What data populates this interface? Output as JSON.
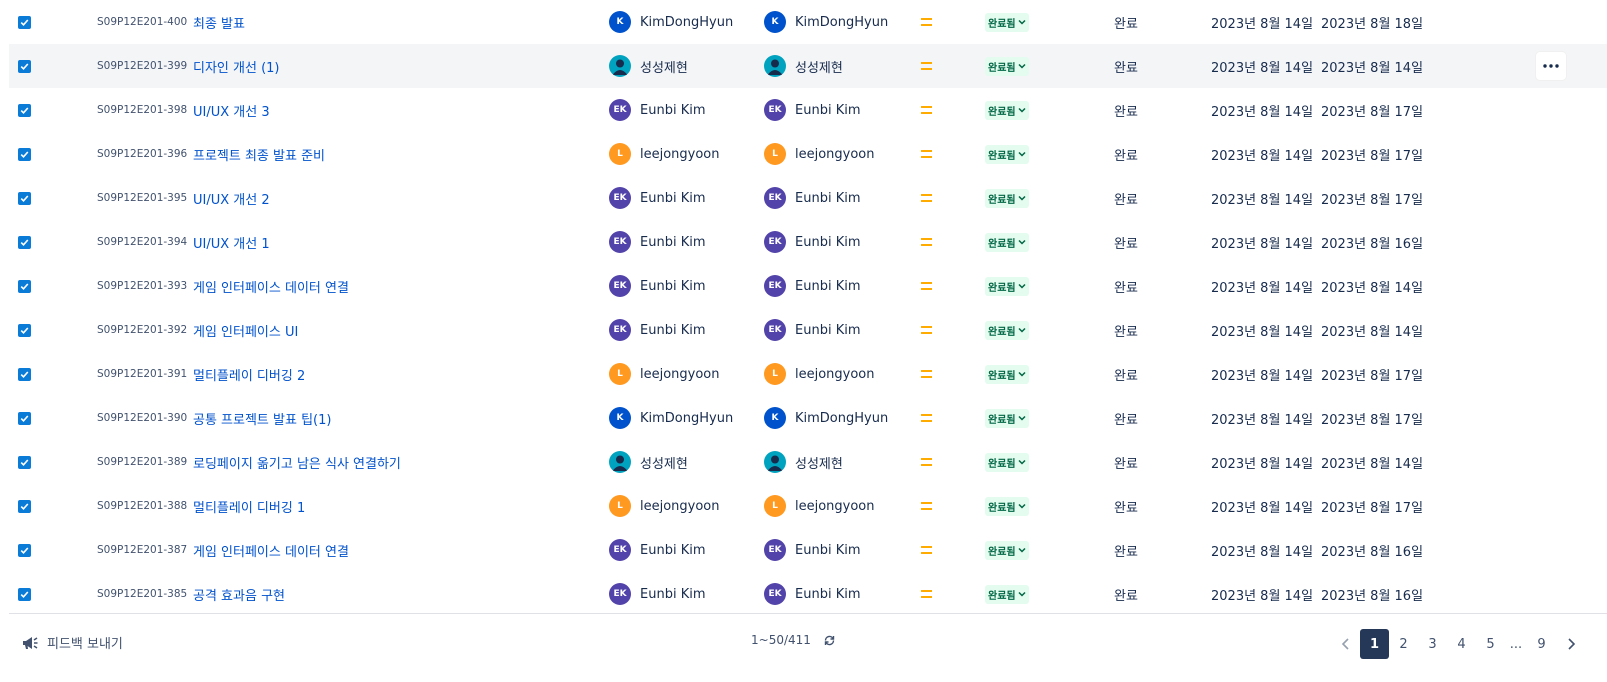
{
  "issues": [
    {
      "key": "S09P12E201-400",
      "summary": "최종 발표",
      "assignee": {
        "name": "KimDongHyun",
        "initials": "K",
        "color": "#0052cc",
        "type": "initials"
      },
      "reporter": {
        "name": "KimDongHyun",
        "initials": "K",
        "color": "#0052cc",
        "type": "initials"
      },
      "priority": "medium",
      "status": "완료됨",
      "resolution": "완료",
      "created": "2023년 8월 14일",
      "updated": "2023년 8월 18일"
    },
    {
      "key": "S09P12E201-399",
      "summary": "디자인 개선 (1)",
      "assignee": {
        "name": "성성제현",
        "initials": "",
        "color": "#00a3bf",
        "type": "person"
      },
      "reporter": {
        "name": "성성제현",
        "initials": "",
        "color": "#00a3bf",
        "type": "person"
      },
      "priority": "medium",
      "status": "완료됨",
      "resolution": "완료",
      "created": "2023년 8월 14일",
      "updated": "2023년 8월 14일"
    },
    {
      "key": "S09P12E201-398",
      "summary": "UI/UX 개선 3",
      "assignee": {
        "name": "Eunbi Kim",
        "initials": "EK",
        "color": "#5243aa",
        "type": "initials"
      },
      "reporter": {
        "name": "Eunbi Kim",
        "initials": "EK",
        "color": "#5243aa",
        "type": "initials"
      },
      "priority": "medium",
      "status": "완료됨",
      "resolution": "완료",
      "created": "2023년 8월 14일",
      "updated": "2023년 8월 17일"
    },
    {
      "key": "S09P12E201-396",
      "summary": "프로젝트 최종 발표 준비",
      "assignee": {
        "name": "leejongyoon",
        "initials": "L",
        "color": "#ff991f",
        "type": "initials"
      },
      "reporter": {
        "name": "leejongyoon",
        "initials": "L",
        "color": "#ff991f",
        "type": "initials"
      },
      "priority": "medium",
      "status": "완료됨",
      "resolution": "완료",
      "created": "2023년 8월 14일",
      "updated": "2023년 8월 17일"
    },
    {
      "key": "S09P12E201-395",
      "summary": "UI/UX 개선 2",
      "assignee": {
        "name": "Eunbi Kim",
        "initials": "EK",
        "color": "#5243aa",
        "type": "initials"
      },
      "reporter": {
        "name": "Eunbi Kim",
        "initials": "EK",
        "color": "#5243aa",
        "type": "initials"
      },
      "priority": "medium",
      "status": "완료됨",
      "resolution": "완료",
      "created": "2023년 8월 14일",
      "updated": "2023년 8월 17일"
    },
    {
      "key": "S09P12E201-394",
      "summary": "UI/UX 개선 1",
      "assignee": {
        "name": "Eunbi Kim",
        "initials": "EK",
        "color": "#5243aa",
        "type": "initials"
      },
      "reporter": {
        "name": "Eunbi Kim",
        "initials": "EK",
        "color": "#5243aa",
        "type": "initials"
      },
      "priority": "medium",
      "status": "완료됨",
      "resolution": "완료",
      "created": "2023년 8월 14일",
      "updated": "2023년 8월 16일"
    },
    {
      "key": "S09P12E201-393",
      "summary": "게임 인터페이스 데이터 연결",
      "assignee": {
        "name": "Eunbi Kim",
        "initials": "EK",
        "color": "#5243aa",
        "type": "initials"
      },
      "reporter": {
        "name": "Eunbi Kim",
        "initials": "EK",
        "color": "#5243aa",
        "type": "initials"
      },
      "priority": "medium",
      "status": "완료됨",
      "resolution": "완료",
      "created": "2023년 8월 14일",
      "updated": "2023년 8월 14일"
    },
    {
      "key": "S09P12E201-392",
      "summary": "게임 인터페이스 UI",
      "assignee": {
        "name": "Eunbi Kim",
        "initials": "EK",
        "color": "#5243aa",
        "type": "initials"
      },
      "reporter": {
        "name": "Eunbi Kim",
        "initials": "EK",
        "color": "#5243aa",
        "type": "initials"
      },
      "priority": "medium",
      "status": "완료됨",
      "resolution": "완료",
      "created": "2023년 8월 14일",
      "updated": "2023년 8월 14일"
    },
    {
      "key": "S09P12E201-391",
      "summary": "멀티플레이 디버깅 2",
      "assignee": {
        "name": "leejongyoon",
        "initials": "L",
        "color": "#ff991f",
        "type": "initials"
      },
      "reporter": {
        "name": "leejongyoon",
        "initials": "L",
        "color": "#ff991f",
        "type": "initials"
      },
      "priority": "medium",
      "status": "완료됨",
      "resolution": "완료",
      "created": "2023년 8월 14일",
      "updated": "2023년 8월 17일"
    },
    {
      "key": "S09P12E201-390",
      "summary": "공통 프로젝트 발표 팁(1)",
      "assignee": {
        "name": "KimDongHyun",
        "initials": "K",
        "color": "#0052cc",
        "type": "initials"
      },
      "reporter": {
        "name": "KimDongHyun",
        "initials": "K",
        "color": "#0052cc",
        "type": "initials"
      },
      "priority": "medium",
      "status": "완료됨",
      "resolution": "완료",
      "created": "2023년 8월 14일",
      "updated": "2023년 8월 17일"
    },
    {
      "key": "S09P12E201-389",
      "summary": "로딩페이지 옮기고 남은 식사 연결하기",
      "assignee": {
        "name": "성성제현",
        "initials": "",
        "color": "#00a3bf",
        "type": "person"
      },
      "reporter": {
        "name": "성성제현",
        "initials": "",
        "color": "#00a3bf",
        "type": "person"
      },
      "priority": "medium",
      "status": "완료됨",
      "resolution": "완료",
      "created": "2023년 8월 14일",
      "updated": "2023년 8월 14일"
    },
    {
      "key": "S09P12E201-388",
      "summary": "멀티플레이 디버깅 1",
      "assignee": {
        "name": "leejongyoon",
        "initials": "L",
        "color": "#ff991f",
        "type": "initials"
      },
      "reporter": {
        "name": "leejongyoon",
        "initials": "L",
        "color": "#ff991f",
        "type": "initials"
      },
      "priority": "medium",
      "status": "완료됨",
      "resolution": "완료",
      "created": "2023년 8월 14일",
      "updated": "2023년 8월 17일"
    },
    {
      "key": "S09P12E201-387",
      "summary": "게임 인터페이스 데이터 연결",
      "assignee": {
        "name": "Eunbi Kim",
        "initials": "EK",
        "color": "#5243aa",
        "type": "initials"
      },
      "reporter": {
        "name": "Eunbi Kim",
        "initials": "EK",
        "color": "#5243aa",
        "type": "initials"
      },
      "priority": "medium",
      "status": "완료됨",
      "resolution": "완료",
      "created": "2023년 8월 14일",
      "updated": "2023년 8월 16일"
    },
    {
      "key": "S09P12E201-385",
      "summary": "공격 효과음 구현",
      "assignee": {
        "name": "Eunbi Kim",
        "initials": "EK",
        "color": "#5243aa",
        "type": "initials"
      },
      "reporter": {
        "name": "Eunbi Kim",
        "initials": "EK",
        "color": "#5243aa",
        "type": "initials"
      },
      "priority": "medium",
      "status": "완료됨",
      "resolution": "완료",
      "created": "2023년 8월 14일",
      "updated": "2023년 8월 16일"
    }
  ],
  "hovered_row": 1,
  "footer": {
    "feedback_label": "피드백 보내기",
    "count_label": "1~50/411",
    "pages": [
      "1",
      "2",
      "3",
      "4",
      "5",
      "...",
      "9"
    ],
    "current_page": "1"
  },
  "icons": {
    "checkbox": "checkbox-checked-icon",
    "priority": "priority-medium-icon",
    "status_dropdown": "chevron-down-icon",
    "more": "more-horizontal-icon",
    "feedback": "megaphone-icon",
    "refresh": "refresh-icon",
    "prev": "chevron-left-icon",
    "next": "chevron-right-icon"
  },
  "colors": {
    "link": "#0052cc",
    "checkbox": "#0b7bd8",
    "priority_medium": "#ffab00",
    "status_done_bg": "#e3fcef",
    "status_done_text": "#006644",
    "pager_current_bg": "#253858"
  }
}
